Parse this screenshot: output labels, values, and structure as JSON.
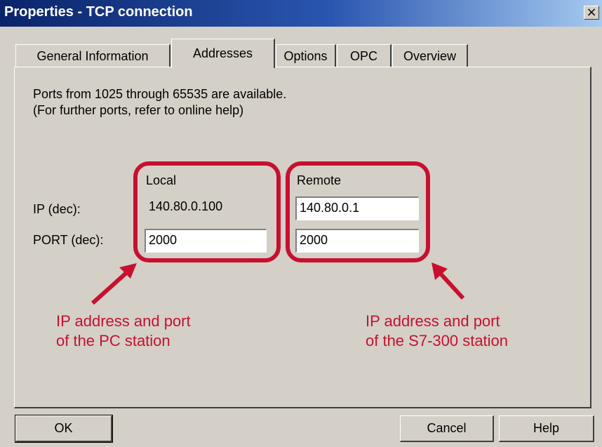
{
  "window": {
    "title": "Properties - TCP connection",
    "close_label": "×"
  },
  "tabs": [
    {
      "label": "General Information"
    },
    {
      "label": "Addresses"
    },
    {
      "label": "Options"
    },
    {
      "label": "OPC"
    },
    {
      "label": "Overview"
    }
  ],
  "active_tab": "Addresses",
  "info": {
    "line1": "Ports from 1025 through 65535 are available.",
    "line2": "(For further ports, refer to online help)"
  },
  "addresses": {
    "local_header": "Local",
    "remote_header": "Remote",
    "ip_label": "IP (dec):",
    "port_label": "PORT (dec):",
    "local_ip": "140.80.0.100",
    "local_port": "2000",
    "remote_ip": "140.80.0.1",
    "remote_port": "2000"
  },
  "annotations": {
    "local_line1": "IP address and port",
    "local_line2": "of the PC station",
    "remote_line1": "IP address and port",
    "remote_line2": "of the S7-300 station",
    "color": "#c8102e"
  },
  "buttons": {
    "ok": "OK",
    "cancel": "Cancel",
    "help": "Help"
  }
}
